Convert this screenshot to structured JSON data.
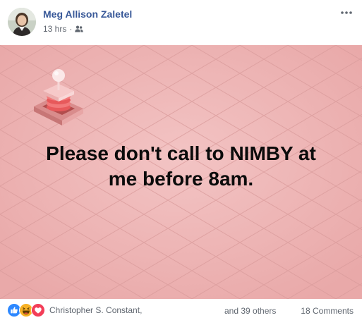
{
  "post": {
    "author": "Meg Allison Zaletel",
    "timestamp": "13 hrs",
    "separator": "·",
    "audience_icon": "friends-icon",
    "more_icon": "more-options-icon",
    "text_lines": "Please don't call to NIMBY at\nme before 8am.",
    "background_color": "#ecb0b0"
  },
  "footer": {
    "reactions": [
      "like",
      "haha",
      "love"
    ],
    "reaction_colors": {
      "like": "#2d88ff",
      "haha": "#f7b125",
      "love": "#f33e58"
    },
    "reactor_name": "Christopher S. Constant,",
    "others": "and 39 others",
    "comments": "18 Comments"
  }
}
